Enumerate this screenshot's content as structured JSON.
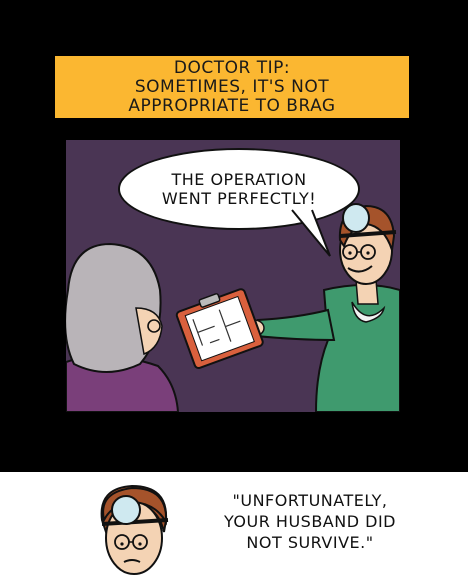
{
  "caption": {
    "lines": [
      "DOCTOR TIP:",
      "SOMETIMES, IT'S NOT",
      "APPROPRIATE TO BRAG"
    ]
  },
  "speech": {
    "lines": [
      "THE OPERATION",
      "WENT PERFECTLY!"
    ]
  },
  "footer_quote": {
    "lines": [
      "\"UNFORTUNATELY,",
      "YOUR HUSBAND DID",
      "NOT SURVIVE.\""
    ]
  },
  "colors": {
    "frame": "#000000",
    "caption_bg": "#fbb731",
    "scene_bg": "#4a3554",
    "scrubs": "#3f9a6e",
    "hair_brown": "#a5532b",
    "hair_gray": "#b9b4b8",
    "clipboard": "#d9603d",
    "mirror": "#cfe9f0",
    "skin": "#f4d3b4",
    "old_woman_shirt": "#7a3f7a"
  }
}
